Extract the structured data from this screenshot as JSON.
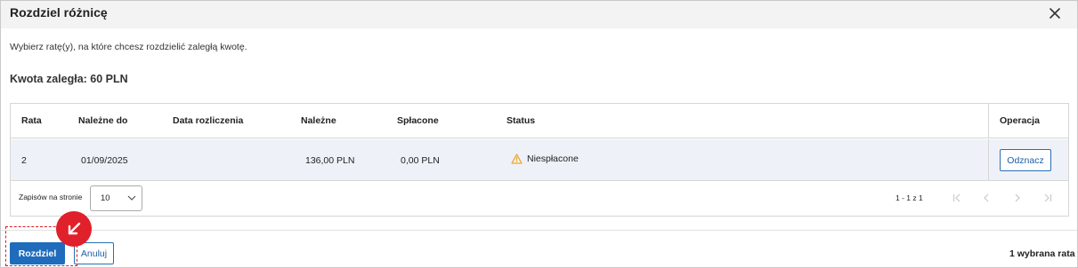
{
  "dialog": {
    "title": "Rozdziel różnicę",
    "description": "Wybierz ratę(y), na które chcesz rozdzielić zaległą kwotę.",
    "amount_text": "Kwota zaległa: 60 PLN"
  },
  "table": {
    "headers": {
      "rata": "Rata",
      "nalezne_do": "Należne do",
      "data_rozliczenia": "Data rozliczenia",
      "nalezne": "Należne",
      "splacone": "Spłacone",
      "status": "Status",
      "operacja": "Operacja"
    },
    "rows": [
      {
        "rata": "2",
        "nalezne_do": "01/09/2025",
        "data_rozliczenia": "",
        "nalezne": "136,00 PLN",
        "splacone": "0,00 PLN",
        "status": "Niespłacone",
        "status_icon": "warning-icon",
        "action_label": "Odznacz"
      }
    ]
  },
  "pagination": {
    "rows_per_page_label": "Zapisów na stronie",
    "rows_per_page_value": "10",
    "range_text": "1 - 1 z 1"
  },
  "footer": {
    "primary_label": "Rozdziel",
    "secondary_label": "Anuluj",
    "selected_text": "1 wybrana rata"
  },
  "colors": {
    "primary": "#1f6cbd",
    "row_selected": "#eef2f8",
    "warning": "#f0a830",
    "highlight": "#d91a22"
  }
}
